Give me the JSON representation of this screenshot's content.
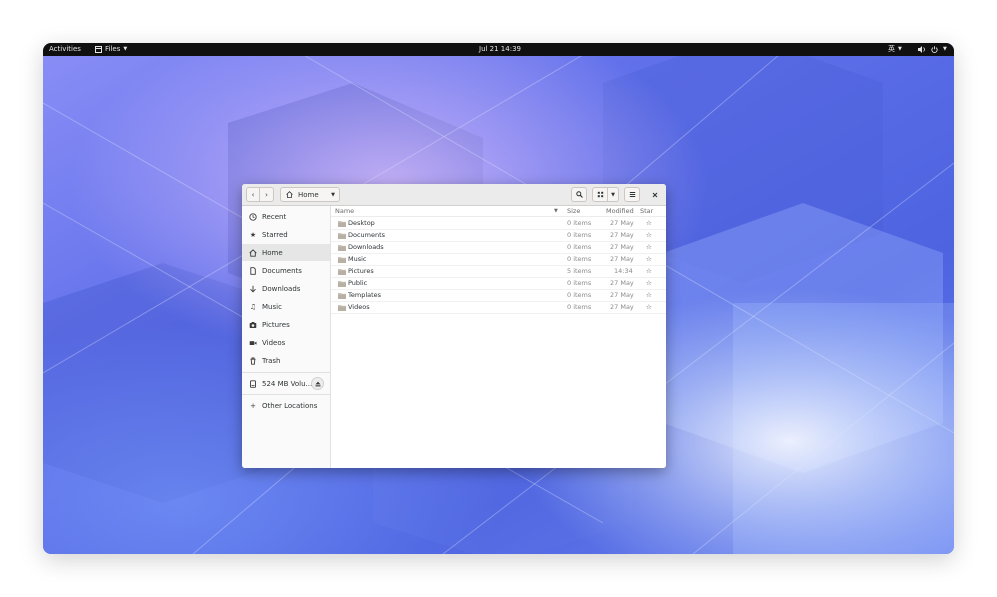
{
  "topbar": {
    "activities": "Activities",
    "app_menu": "Files",
    "clock": "Jul 21  14:39",
    "input_method": "英"
  },
  "headerbar": {
    "location": "Home"
  },
  "sidebar": {
    "items": [
      {
        "label": "Recent",
        "icon": "clock-icon"
      },
      {
        "label": "Starred",
        "icon": "star-icon"
      },
      {
        "label": "Home",
        "icon": "home-icon"
      },
      {
        "label": "Documents",
        "icon": "document-icon"
      },
      {
        "label": "Downloads",
        "icon": "download-icon"
      },
      {
        "label": "Music",
        "icon": "music-icon"
      },
      {
        "label": "Pictures",
        "icon": "camera-icon"
      },
      {
        "label": "Videos",
        "icon": "video-icon"
      },
      {
        "label": "Trash",
        "icon": "trash-icon"
      }
    ],
    "volume": "524 MB Volu...",
    "other_locations": "Other Locations"
  },
  "list": {
    "columns": {
      "name": "Name",
      "size": "Size",
      "modified": "Modified",
      "star": "Star"
    },
    "rows": [
      {
        "name": "Desktop",
        "size": "0 items",
        "modified": "27 May"
      },
      {
        "name": "Documents",
        "size": "0 items",
        "modified": "27 May"
      },
      {
        "name": "Downloads",
        "size": "0 items",
        "modified": "27 May"
      },
      {
        "name": "Music",
        "size": "0 items",
        "modified": "27 May"
      },
      {
        "name": "Pictures",
        "size": "5 items",
        "modified": "14:34"
      },
      {
        "name": "Public",
        "size": "0 items",
        "modified": "27 May"
      },
      {
        "name": "Templates",
        "size": "0 items",
        "modified": "27 May"
      },
      {
        "name": "Videos",
        "size": "0 items",
        "modified": "27 May"
      }
    ]
  },
  "colors": {
    "topbar": "#101010",
    "wallpaper_base": "#5b6ae8",
    "headerbar": "#ebebeb",
    "sidebar": "#fafafa",
    "folder": "#c9c2b8"
  }
}
